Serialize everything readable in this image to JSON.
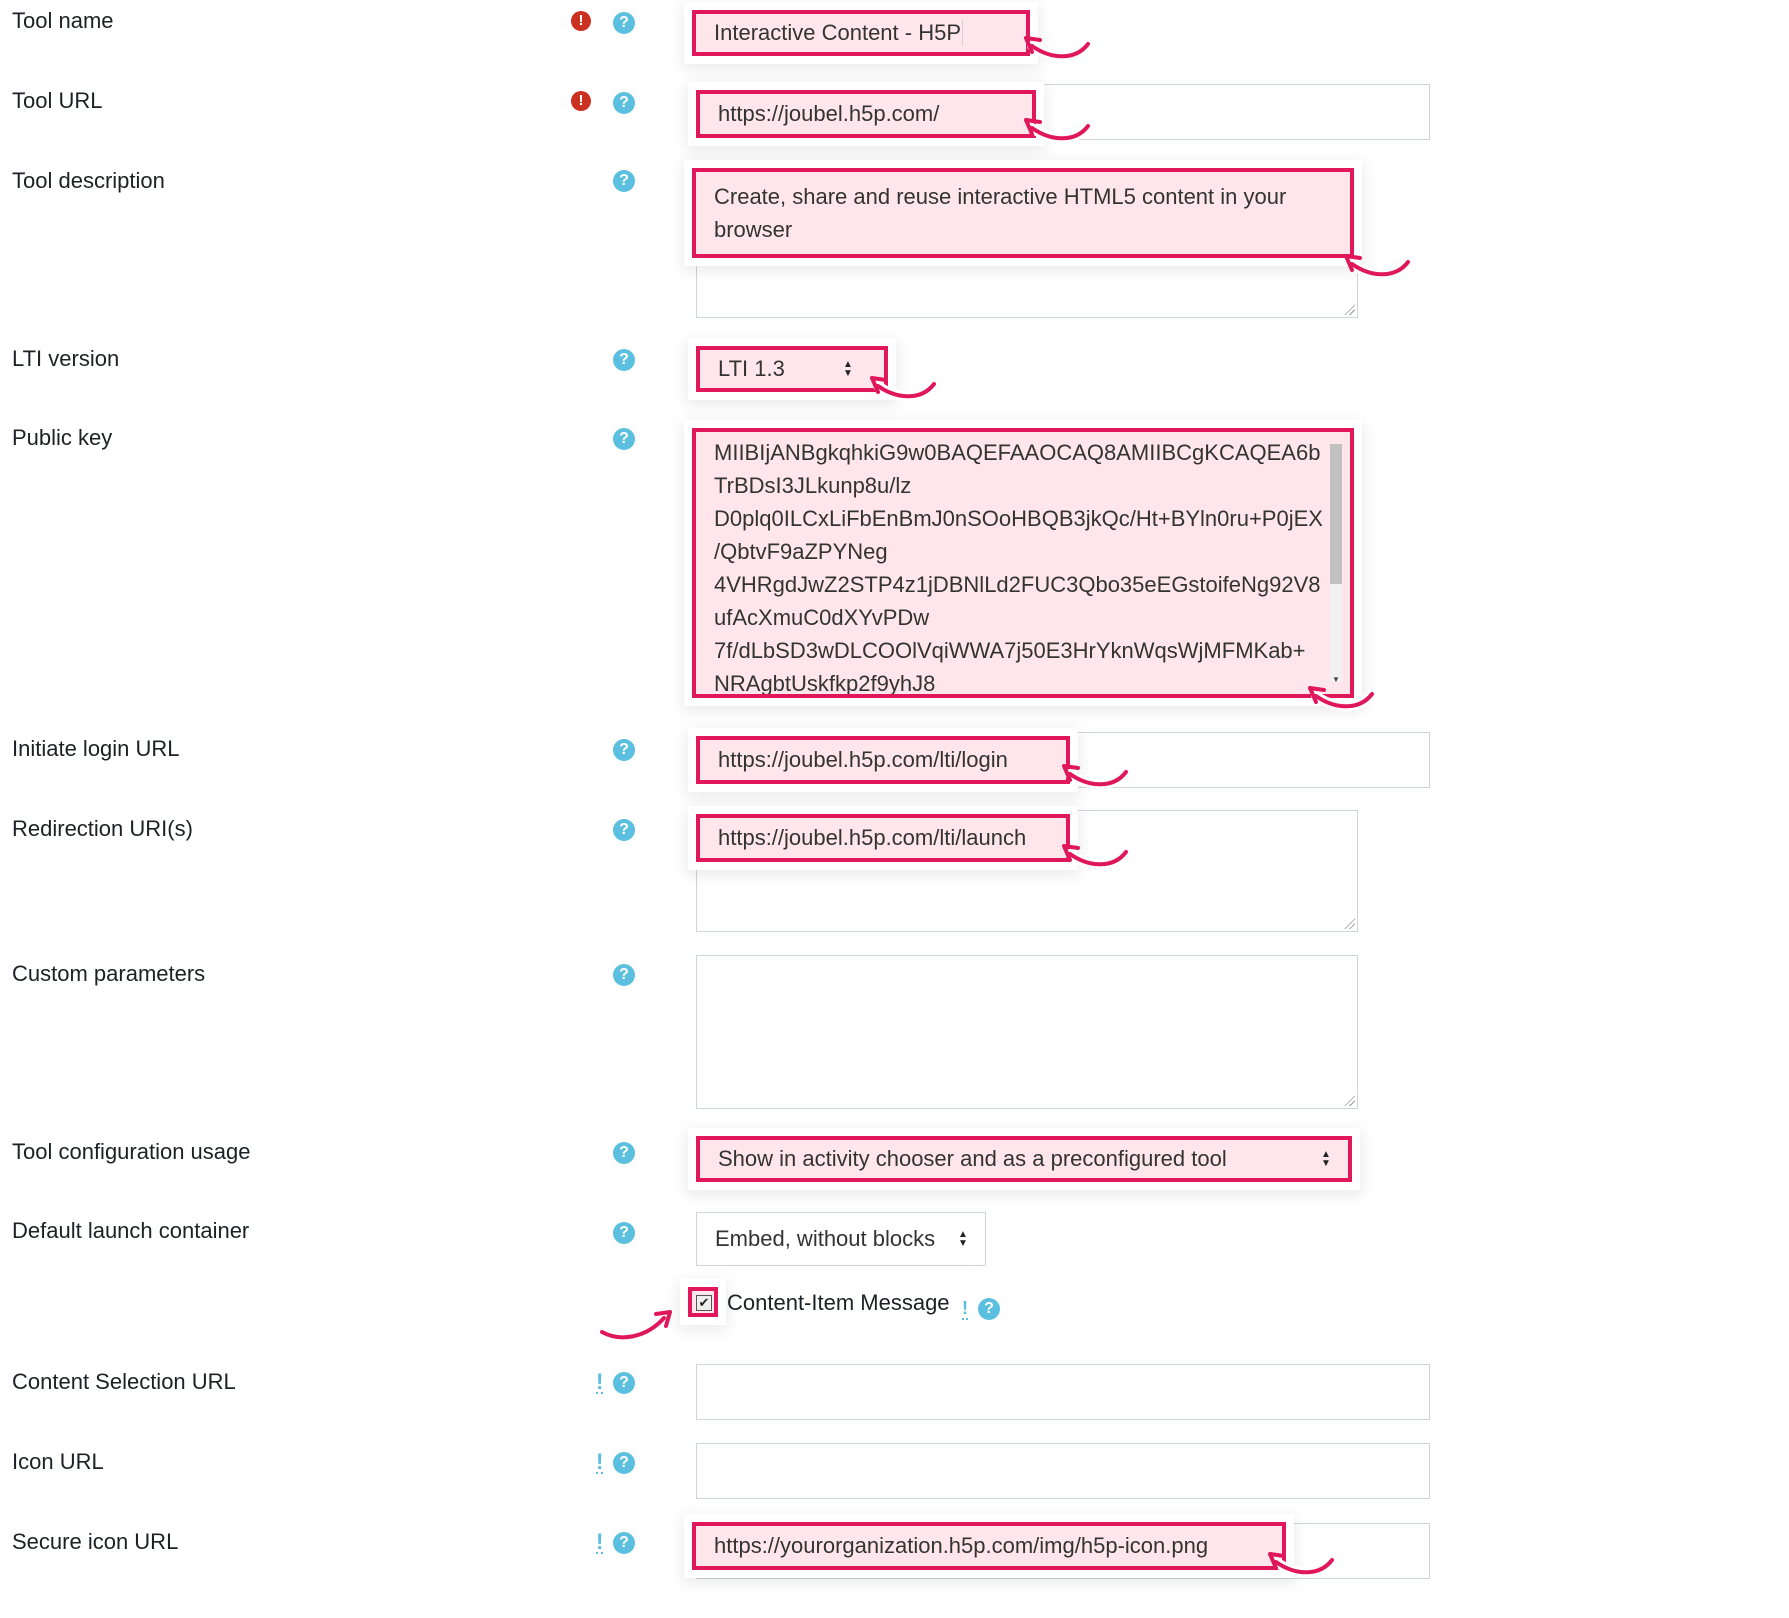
{
  "fields": {
    "tool_name": {
      "label": "Tool name",
      "value": "Interactive Content - H5P"
    },
    "tool_url": {
      "label": "Tool URL",
      "value": "https://joubel.h5p.com/"
    },
    "tool_description": {
      "label": "Tool description",
      "value": "Create, share and reuse interactive HTML5 content in your browser"
    },
    "lti_version": {
      "label": "LTI version",
      "value": "LTI 1.3"
    },
    "public_key": {
      "label": "Public key",
      "lines": [
        "MIIBIjANBgkqhkiG9w0BAQEFAAOCAQ8AMIIBCgKCAQEA6b",
        "TrBDsI3JLkunp8u/lz",
        "D0plq0ILCxLiFbEnBmJ0nSOoHBQB3jkQc/Ht+BYln0ru+P0jEX",
        "/QbtvF9aZPYNeg",
        "4VHRgdJwZ2STP4z1jDBNlLd2FUC3Qbo35eEGstoifeNg92V8",
        "ufAcXmuC0dXYvPDw",
        "7f/dLbSD3wDLCOOlVqiWWA7j50E3HrYknWqsWjMFMKab+",
        "NRAgbtUskfkp2f9yhJ8"
      ]
    },
    "initiate_login_url": {
      "label": "Initiate login URL",
      "value": "https://joubel.h5p.com/lti/login"
    },
    "redirection_uris": {
      "label": "Redirection URI(s)",
      "value": "https://joubel.h5p.com/lti/launch"
    },
    "custom_parameters": {
      "label": "Custom parameters",
      "value": ""
    },
    "tool_configuration_usage": {
      "label": "Tool configuration usage",
      "value": "Show in activity chooser and as a preconfigured tool"
    },
    "default_launch_container": {
      "label": "Default launch container",
      "value": "Embed, without blocks"
    },
    "content_item_message": {
      "label": "Content-Item Message",
      "checked": true
    },
    "content_selection_url": {
      "label": "Content Selection URL",
      "value": ""
    },
    "icon_url": {
      "label": "Icon URL",
      "value": ""
    },
    "secure_icon_url": {
      "label": "Secure icon URL",
      "value": "https://yourorganization.h5p.com/img/h5p-icon.png"
    }
  },
  "icons": {
    "required": "exclamation-circle-icon",
    "help": "question-circle-icon",
    "advanced": "exclamation-mark"
  },
  "symbols": {
    "req": "!",
    "help": "?",
    "adv": "!",
    "check": "✔",
    "updown": "▲▼",
    "down": "▼"
  },
  "colors": {
    "highlight_border": "#e0175b",
    "highlight_fill": "#ffe6ec",
    "help": "#5bbfe0",
    "required": "#ca3120"
  }
}
